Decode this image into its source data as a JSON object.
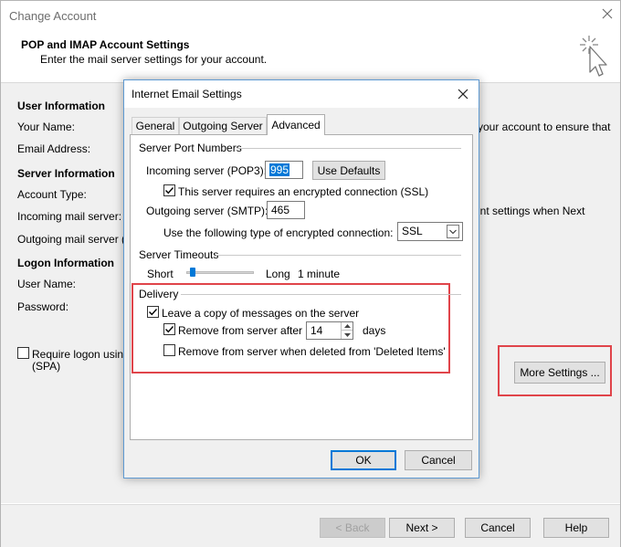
{
  "outer": {
    "title": "Change Account",
    "heading": "POP and IMAP Account Settings",
    "subheading": "Enter the mail server settings for your account.",
    "sections": {
      "user_info": "User Information",
      "your_name": "Your Name:",
      "email": "Email Address:",
      "server_info": "Server Information",
      "account_type": "Account Type:",
      "incoming": "Incoming mail server:",
      "outgoing": "Outgoing mail server (S",
      "logon_info": "Logon Information",
      "user_name": "User Name:",
      "password": "Password:",
      "spa_line1": "Require logon using",
      "spa_line2": "(SPA)"
    },
    "right_text_1": "your account to ensure that",
    "right_text_2": "unt settings when Next",
    "more_settings": "More Settings ...",
    "buttons": {
      "back": "< Back",
      "next": "Next >",
      "cancel": "Cancel",
      "help": "Help"
    }
  },
  "dialog": {
    "title": "Internet Email Settings",
    "tabs": [
      "General",
      "Outgoing Server",
      "Advanced"
    ],
    "active_tab": "Advanced",
    "server_ports": {
      "group": "Server Port Numbers",
      "incoming_label": "Incoming server (POP3):",
      "incoming_value": "995",
      "use_defaults": "Use Defaults",
      "ssl_checkbox": "This server requires an encrypted connection (SSL)",
      "ssl_checked": true,
      "outgoing_label": "Outgoing server (SMTP):",
      "outgoing_value": "465",
      "enc_label": "Use the following type of encrypted connection:",
      "enc_value": "SSL"
    },
    "timeouts": {
      "group": "Server Timeouts",
      "short": "Short",
      "long": "Long",
      "value": "1 minute"
    },
    "delivery": {
      "group": "Delivery",
      "leave_copy": "Leave a copy of messages on the server",
      "leave_copy_checked": true,
      "remove_after": "Remove from server after",
      "remove_after_checked": true,
      "days_value": "14",
      "days_label": "days",
      "remove_deleted": "Remove from server when deleted from 'Deleted Items'",
      "remove_deleted_checked": false
    },
    "buttons": {
      "ok": "OK",
      "cancel": "Cancel"
    }
  },
  "colors": {
    "highlight": "#e0444a",
    "accent": "#0078d7"
  }
}
